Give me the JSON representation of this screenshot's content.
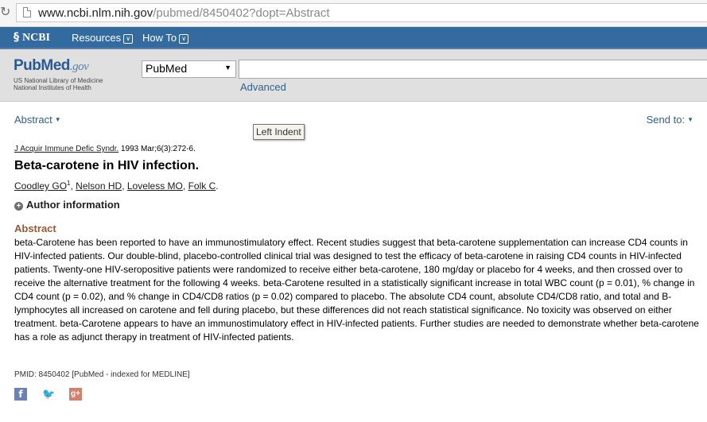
{
  "browser": {
    "url_host": "www.ncbi.nlm.nih.gov",
    "url_path": "/pubmed/8450402?dopt=Abstract"
  },
  "ncbi_bar": {
    "logo": "NCBI",
    "menus": [
      "Resources",
      "How To"
    ]
  },
  "search": {
    "logo_pub": "Pub",
    "logo_med": "Med",
    "logo_gov": ".gov",
    "logo_sub1": "US National Library of Medicine",
    "logo_sub2": "National Institutes of Health",
    "database_selected": "PubMed",
    "query_value": "",
    "advanced_label": "Advanced"
  },
  "toolbar": {
    "format_label": "Abstract",
    "send_to_label": "Send to:"
  },
  "tooltip": "Left Indent",
  "article": {
    "journal": "J Acquir Immune Defic Syndr.",
    "citation": " 1993 Mar;6(3):272-6.",
    "title": "Beta-carotene in HIV infection.",
    "authors": [
      "Coodley GO",
      "Nelson HD",
      "Loveless MO",
      "Folk C"
    ],
    "first_author_sup": "1",
    "author_info_label": "Author information",
    "abstract_heading": "Abstract",
    "abstract_text": "beta-Carotene has been reported to have an immunostimulatory effect. Recent studies suggest that beta-carotene supplementation can increase CD4 counts in HIV-infected patients. Our double-blind, placebo-controlled clinical trial was designed to test the efficacy of beta-carotene in raising CD4 counts in HIV-infected patients. Twenty-one HIV-seropositive patients were randomized to receive either beta-carotene, 180 mg/day or placebo for 4 weeks, and then crossed over to receive the alternative treatment for the following 4 weeks. beta-Carotene resulted in a statistically significant increase in total WBC count (p = 0.01), % change in CD4 count (p = 0.02), and % change in CD4/CD8 ratios (p = 0.02) compared to placebo. The absolute CD4 count, absolute CD4/CD8 ratio, and total and B-lymphocytes all increased on carotene and fell during placebo, but these differences did not reach statistical significance. No toxicity was observed on either treatment. beta-Carotene appears to have an immunostimulatory effect in HIV-infected patients. Further studies are needed to demonstrate whether beta-carotene has a role as adjunct therapy in treatment of HIV-infected patients.",
    "pmid_line": "PMID: 8450402 [PubMed - indexed for MEDLINE]"
  },
  "social": {
    "facebook_glyph": "f",
    "twitter_glyph": "🐦",
    "googleplus_glyph": "g+"
  }
}
